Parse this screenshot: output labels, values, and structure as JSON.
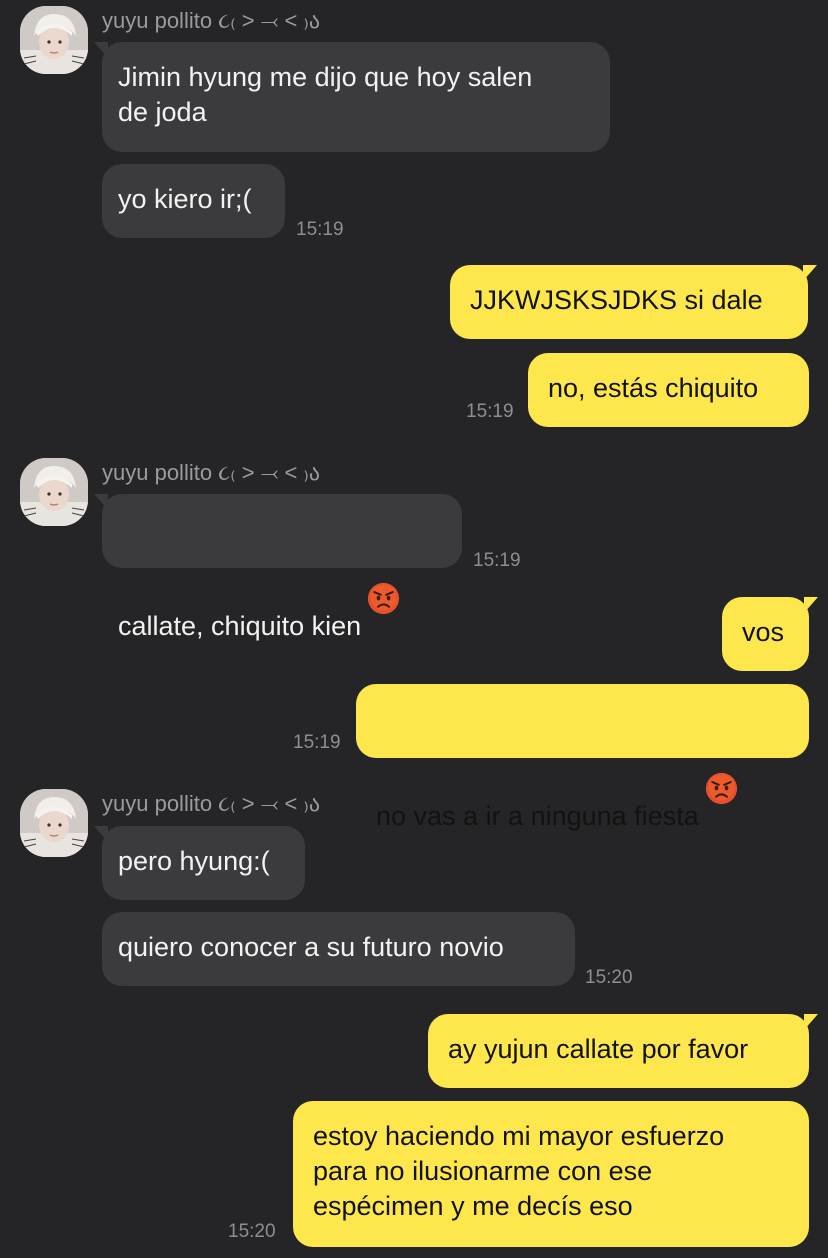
{
  "chat": {
    "sender_name": "yuyu pollito ૮₍ ˃ ⤙ ˂ ₎ა",
    "groups": [
      {
        "type": "incoming",
        "messages": [
          "Jimin hyung me dijo que hoy salen\nde joda",
          "yo kiero ir;("
        ],
        "time": "15:19"
      },
      {
        "type": "outgoing",
        "messages": [
          "JJKWJSKSJDKS si dale",
          "no, estás chiquito"
        ],
        "time": "15:19"
      },
      {
        "type": "incoming",
        "messages": [
          "callate, chiquito kien"
        ],
        "emoji": "angry-face",
        "time": "15:19"
      },
      {
        "type": "outgoing",
        "messages": [
          "vos",
          "no vas a ir a ninguna fiesta"
        ],
        "emoji": "angry-face",
        "time": "15:19"
      },
      {
        "type": "incoming",
        "messages": [
          "pero hyung:(",
          "quiero conocer a su futuro novio"
        ],
        "time": "15:20"
      },
      {
        "type": "outgoing",
        "messages": [
          "ay yujun callate por favor",
          "estoy haciendo mi mayor esfuerzo\npara no ilusionarme con ese\nespécimen y me decís eso"
        ],
        "time": "15:20"
      }
    ]
  },
  "colors": {
    "background": "#252527",
    "incoming_bubble": "#3b3b3e",
    "outgoing_bubble": "#fde74c",
    "timestamp": "#8e8e92",
    "sender_name": "#9b9b9f"
  },
  "icons": {
    "avatar": "profile-photo-avatar",
    "emoji": "angry-face-emoji"
  }
}
